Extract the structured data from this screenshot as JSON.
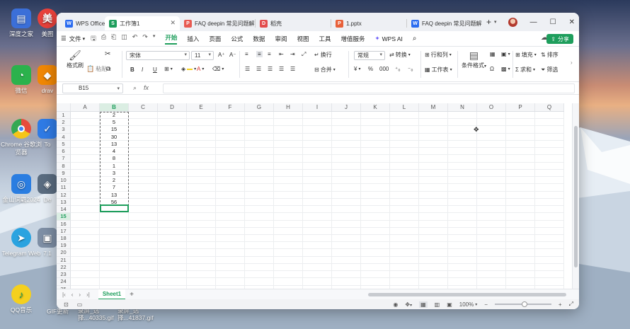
{
  "desktop": {
    "icons": [
      {
        "label": "深度之家",
        "color": "#3b6fd8",
        "glyph": "▤"
      },
      {
        "label": "微信",
        "color": "#2bb24c",
        "glyph": "◔"
      },
      {
        "label": "Chrome 谷歌浏览器",
        "color": "#e8e8e8",
        "glyph": "◉"
      },
      {
        "label": "金山词霸2024",
        "color": "#2a7de1",
        "glyph": "◎"
      },
      {
        "label": "Telegram Web",
        "color": "#2aa3e0",
        "glyph": "➤"
      },
      {
        "label": "QQ音乐",
        "color": "#f5d01e",
        "glyph": "♪"
      }
    ],
    "col2_labels": [
      "美图",
      "drav",
      "To",
      "De",
      "7.1"
    ],
    "bottom_files": [
      "GIF更新",
      "录屏_选择...40335.gif",
      "录屏_选择...41837.gif"
    ]
  },
  "titlebar": {
    "tabs": [
      {
        "label": "WPS Office",
        "icon": "wps-logo-icon",
        "color": "#2b6cf0",
        "glyph": "W"
      },
      {
        "label": "工作簿1",
        "icon": "sheet-icon",
        "color": "#1e9e5c",
        "glyph": "S",
        "active": true
      },
      {
        "label": "FAQ  deepin 常见问题解",
        "icon": "pdf-icon",
        "color": "#e85b52",
        "glyph": "P"
      },
      {
        "label": "稻壳",
        "icon": "docer-icon",
        "color": "#e34d4d",
        "glyph": "D"
      },
      {
        "label": "1.pptx",
        "icon": "ppt-icon",
        "color": "#e8613a",
        "glyph": "P"
      },
      {
        "label": "FAQ  deepin 常见问题解",
        "icon": "word-icon",
        "color": "#2b6cf0",
        "glyph": "W"
      }
    ],
    "add_tab": "+",
    "minimize": "—",
    "maximize": "☐",
    "close": "✕"
  },
  "menubar": {
    "file": "文件",
    "items": [
      "开始",
      "插入",
      "页面",
      "公式",
      "数据",
      "审阅",
      "视图",
      "工具",
      "增值服务"
    ],
    "active": "开始",
    "wps_ai": "WPS AI",
    "share": "分享"
  },
  "ribbon": {
    "format_painter": "格式刷",
    "paste": "粘贴",
    "font_name": "宋体",
    "font_size": "11",
    "bold": "B",
    "italic": "I",
    "underline": "U",
    "wrap": "换行",
    "merge": "合并",
    "number_format": "常规",
    "convert": "转换",
    "rows_cols": "行和列",
    "worksheet": "工作表",
    "cond_format": "条件格式",
    "fill": "填充",
    "sort": "排序",
    "sum": "求和",
    "filter": "筛选",
    "font_color": "#d9302c",
    "fill_color": "#f5d01e"
  },
  "formula_bar": {
    "name_box": "B15",
    "fx": "fx",
    "value": ""
  },
  "grid": {
    "columns": [
      "A",
      "B",
      "C",
      "D",
      "E",
      "F",
      "G",
      "H",
      "I",
      "J",
      "K",
      "L",
      "M",
      "N",
      "O",
      "P",
      "Q"
    ],
    "selected_column": "B",
    "rows": [
      "1",
      "2",
      "3",
      "4",
      "5",
      "6",
      "7",
      "8",
      "9",
      "10",
      "11",
      "12",
      "13",
      "14",
      "15",
      "16",
      "17",
      "18",
      "19",
      "20",
      "21",
      "22",
      "23",
      "24",
      "25"
    ],
    "selected_row": "15",
    "column_b_values": [
      "2",
      "5",
      "15",
      "30",
      "13",
      "4",
      "8",
      "1",
      "3",
      "2",
      "7",
      "13",
      "56"
    ]
  },
  "sheets": {
    "tabs": [
      "Sheet1"
    ],
    "add": "+"
  },
  "status": {
    "zoom": "100%"
  }
}
